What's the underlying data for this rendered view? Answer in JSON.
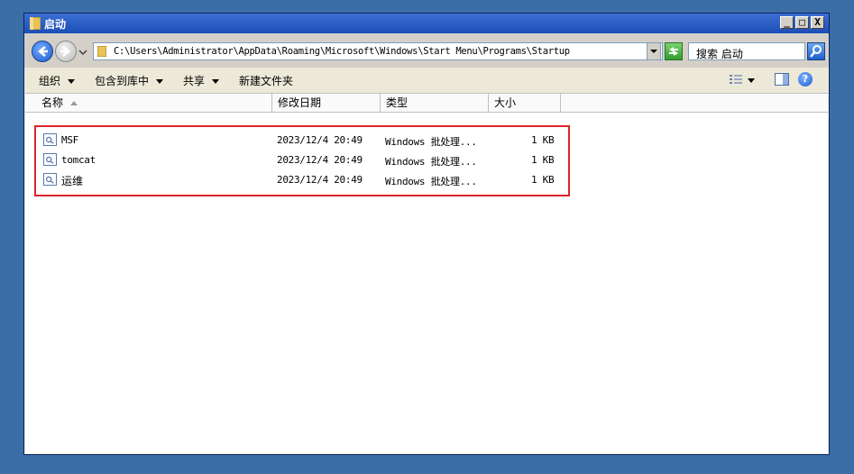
{
  "window": {
    "title": "启动",
    "buttons": {
      "minimize": "_",
      "maximize": "□",
      "close": "X"
    }
  },
  "address": {
    "path": "C:\\Users\\Administrator\\AppData\\Roaming\\Microsoft\\Windows\\Start Menu\\Programs\\Startup",
    "search_placeholder": "搜索 启动"
  },
  "toolbar": {
    "organize": "组织",
    "include_in_library": "包含到库中",
    "share": "共享",
    "new_folder": "新建文件夹",
    "help": "?"
  },
  "columns": {
    "name": "名称",
    "modified": "修改日期",
    "type": "类型",
    "size": "大小"
  },
  "files": [
    {
      "name": "MSF",
      "modified": "2023/12/4 20:49",
      "type": "Windows 批处理...",
      "size": "1 KB"
    },
    {
      "name": "tomcat",
      "modified": "2023/12/4 20:49",
      "type": "Windows 批处理...",
      "size": "1 KB"
    },
    {
      "name": "运维",
      "modified": "2023/12/4 20:49",
      "type": "Windows 批处理...",
      "size": "1 KB"
    }
  ],
  "colors": {
    "highlight": "#e0232a",
    "titlebar": "#1c4fb8",
    "desktop": "#3a6ea5"
  }
}
